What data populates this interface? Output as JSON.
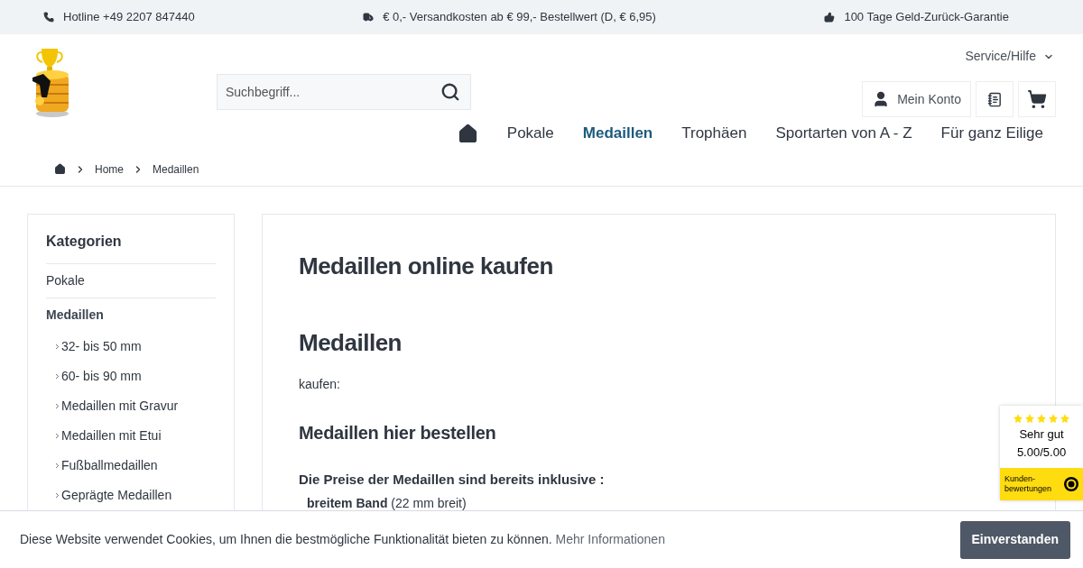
{
  "top_bar": [
    {
      "kind": "phone",
      "text": "Hotline +49 2207 847440"
    },
    {
      "kind": "truck",
      "text": "€ 0,- Versandkosten ab € 99,- Bestellwert (D, € 6,95)"
    },
    {
      "kind": "thumb",
      "text": "100 Tage Geld-Zurück-Garantie"
    }
  ],
  "service_menu": "Service/Hilfe",
  "search": {
    "placeholder": "Suchbegriff..."
  },
  "account_button": "Mein Konto",
  "nav": [
    {
      "label": "Pokale",
      "selected": false
    },
    {
      "label": "Medaillen",
      "selected": true
    },
    {
      "label": "Trophäen",
      "selected": false
    },
    {
      "label": "Sportarten von A - Z",
      "selected": false
    },
    {
      "label": "Für ganz Eilige",
      "selected": false
    }
  ],
  "breadcrumb": [
    "Home",
    "Medaillen"
  ],
  "sidebar": {
    "title": "Kategorien",
    "items": [
      {
        "label": "Pokale",
        "selected": false
      },
      {
        "label": "Medaillen",
        "selected": true,
        "children": [
          "32- bis 50 mm",
          "60- bis 90 mm",
          "Medaillen mit Gravur",
          "Medaillen mit Etui",
          "Fußballmedaillen",
          "Geprägte Medaillen"
        ]
      }
    ]
  },
  "content": {
    "title": "Medaillen online kaufen",
    "heading": "Medaillen",
    "intro": "kaufen:",
    "subheading": "Medaillen hier bestellen",
    "prices_heading": "Die Preise der Medaillen sind bereits inklusive :",
    "list": [
      "**breitem Band** (22 mm breit)"
    ]
  },
  "rating_badge": {
    "stars": 5,
    "verdict": "Sehr gut",
    "score": "5.00/5.00",
    "label": "Kunden-\nbewertungen"
  },
  "cookie_bar": {
    "text": "Diese Website verwendet Cookies, um Ihnen die bestmögliche Funktionalität bieten zu können.",
    "link": "Mehr Informationen",
    "button": "Einverstanden"
  }
}
